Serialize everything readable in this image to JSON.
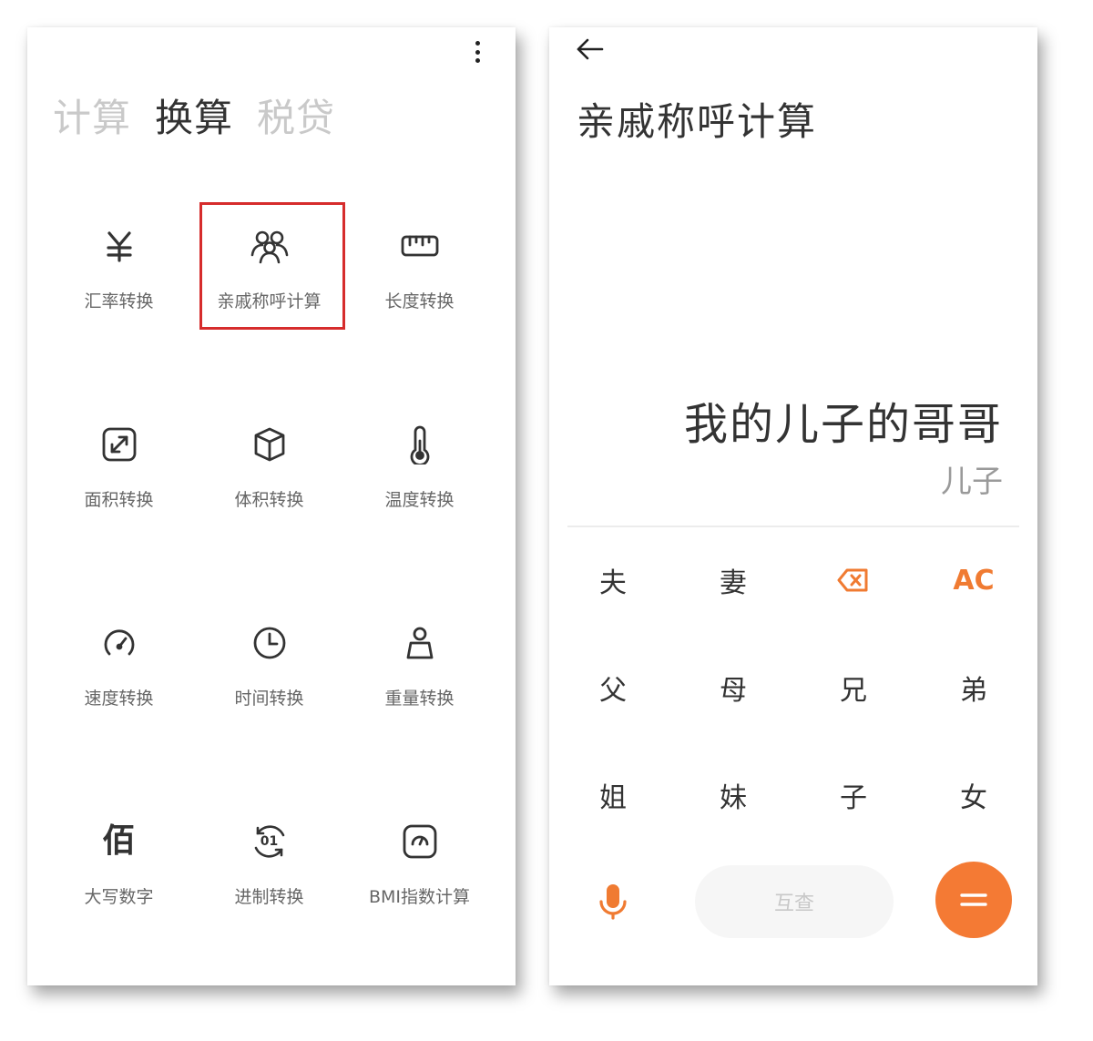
{
  "left": {
    "tabs": [
      {
        "label": "计算",
        "active": false
      },
      {
        "label": "换算",
        "active": true
      },
      {
        "label": "税贷",
        "active": false
      }
    ],
    "grid": [
      {
        "label": "汇率转换",
        "icon": "yuan-icon"
      },
      {
        "label": "亲戚称呼计算",
        "icon": "people-icon",
        "highlighted": true
      },
      {
        "label": "长度转换",
        "icon": "ruler-icon"
      },
      {
        "label": "面积转换",
        "icon": "expand-icon"
      },
      {
        "label": "体积转换",
        "icon": "cube-icon"
      },
      {
        "label": "温度转换",
        "icon": "thermometer-icon"
      },
      {
        "label": "速度转换",
        "icon": "speedometer-icon"
      },
      {
        "label": "时间转换",
        "icon": "clock-icon"
      },
      {
        "label": "重量转换",
        "icon": "weight-icon"
      },
      {
        "label": "大写数字",
        "icon": "bai-glyph-icon",
        "glyph": "佰"
      },
      {
        "label": "进制转换",
        "icon": "binary-icon",
        "glyph": "01"
      },
      {
        "label": "BMI指数计算",
        "icon": "scale-icon"
      }
    ],
    "highlight_color": "#d62c2c"
  },
  "right": {
    "title": "亲戚称呼计算",
    "expression": "我的儿子的哥哥",
    "result": "儿子",
    "keys": [
      {
        "label": "夫"
      },
      {
        "label": "妻"
      },
      {
        "label": "",
        "icon": "backspace-icon",
        "orange": true
      },
      {
        "label": "AC",
        "orange": true
      },
      {
        "label": "父"
      },
      {
        "label": "母"
      },
      {
        "label": "兄"
      },
      {
        "label": "弟"
      },
      {
        "label": "姐"
      },
      {
        "label": "妹"
      },
      {
        "label": "子"
      },
      {
        "label": "女"
      }
    ],
    "mutual_label": "互查",
    "accent_color": "#f47a34"
  }
}
